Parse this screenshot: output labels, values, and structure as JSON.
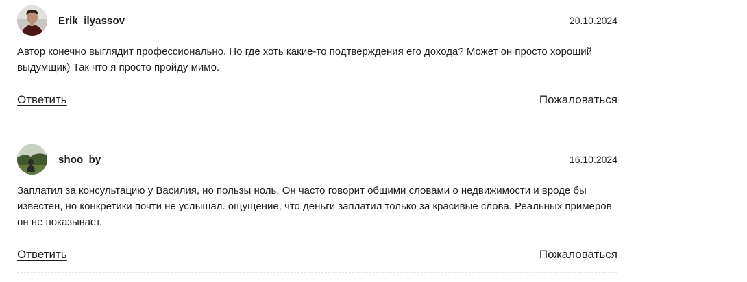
{
  "comments": [
    {
      "username": "Erik_ilyassov",
      "date": "20.10.2024",
      "text": "Автор конечно выглядит профессионально. Но где хоть какие-то подтверждения его дохода? Может он просто хороший выдумщик) Так что я просто пройду мимо.",
      "reply_label": "Ответить",
      "report_label": "Пожаловаться",
      "avatar_icon": "user-photo-avatar"
    },
    {
      "username": "shoo_by",
      "date": "16.10.2024",
      "text": "Заплатил за консультацию у Василия, но пользы ноль. Он часто говорит общими словами о недвижимости и вроде бы известен, но конкретики почти не услышал. ощущение, что деньги заплатил только за красивые слова. Реальных примеров он не показывает.",
      "reply_label": "Ответить",
      "report_label": "Пожаловаться",
      "avatar_icon": "user-photo-avatar"
    }
  ]
}
